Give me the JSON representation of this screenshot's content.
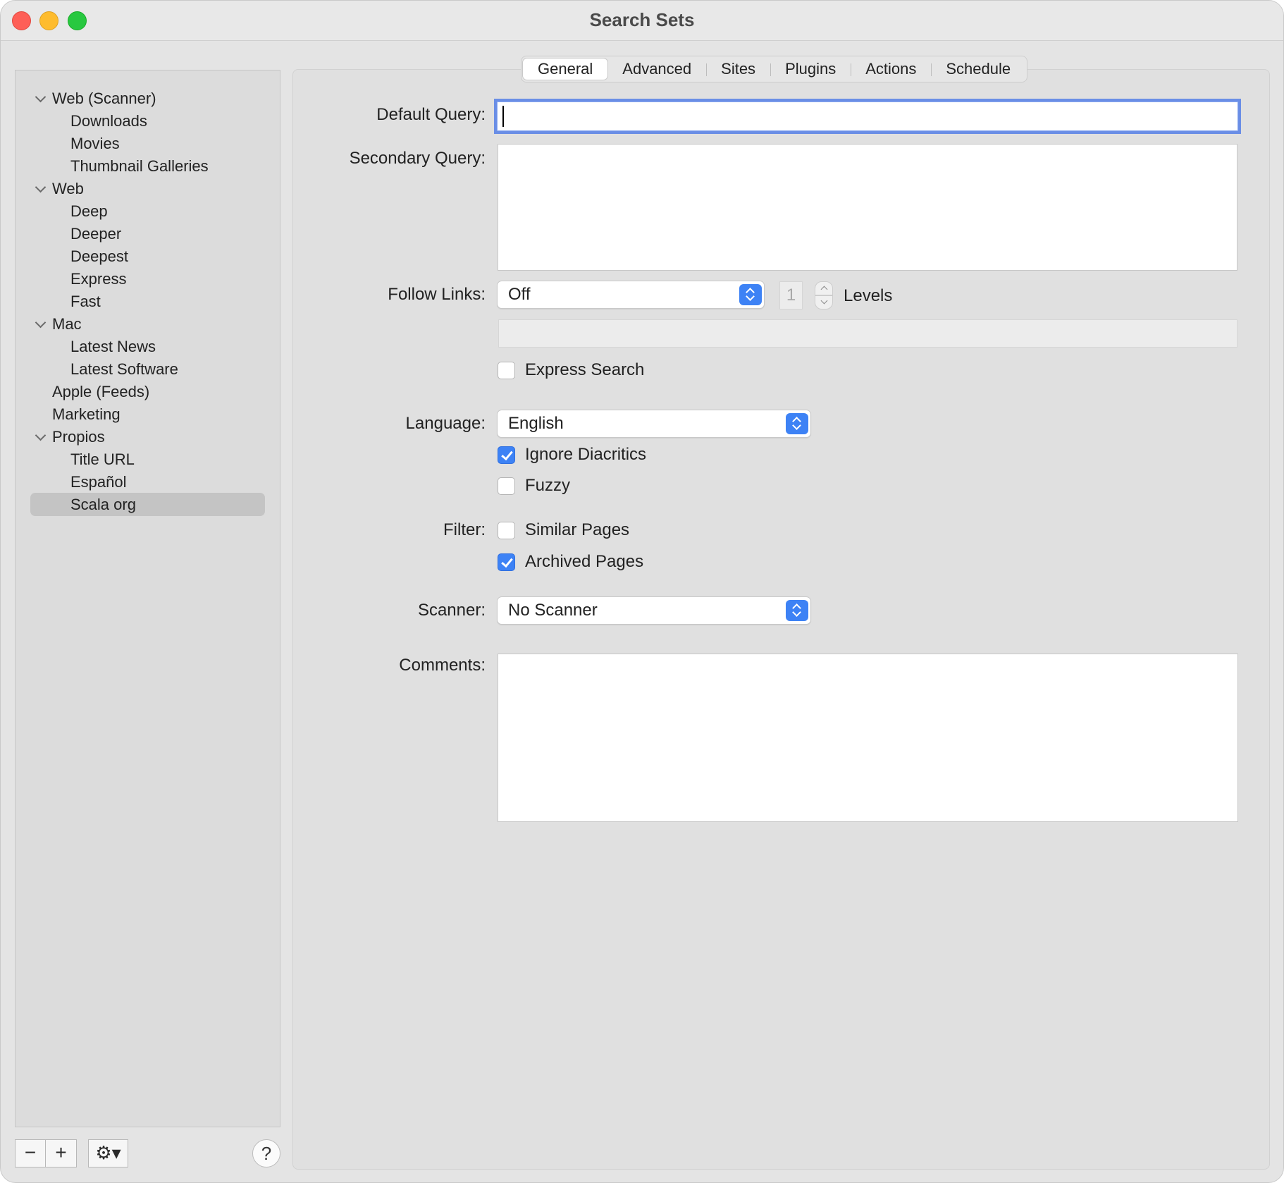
{
  "window": {
    "title": "Search Sets"
  },
  "sidebar": {
    "items": [
      {
        "label": "Web (Scanner)",
        "level": 0,
        "expandable": true
      },
      {
        "label": "Downloads",
        "level": 1
      },
      {
        "label": "Movies",
        "level": 1
      },
      {
        "label": "Thumbnail Galleries",
        "level": 1
      },
      {
        "label": "Web",
        "level": 0,
        "expandable": true
      },
      {
        "label": "Deep",
        "level": 1
      },
      {
        "label": "Deeper",
        "level": 1
      },
      {
        "label": "Deepest",
        "level": 1
      },
      {
        "label": "Express",
        "level": 1
      },
      {
        "label": "Fast",
        "level": 1
      },
      {
        "label": "Mac",
        "level": 0,
        "expandable": true
      },
      {
        "label": "Latest News",
        "level": 1
      },
      {
        "label": "Latest Software",
        "level": 1
      },
      {
        "label": "Apple (Feeds)",
        "level": 0
      },
      {
        "label": "Marketing",
        "level": 0
      },
      {
        "label": "Propios",
        "level": 0,
        "expandable": true
      },
      {
        "label": "Title URL",
        "level": 1
      },
      {
        "label": "Español",
        "level": 1
      },
      {
        "label": "Scala org",
        "level": 1,
        "selected": true
      }
    ],
    "buttons": {
      "remove": "−",
      "add": "+",
      "gear": "⚙▾",
      "help": "?"
    }
  },
  "tabs": [
    {
      "label": "General",
      "active": true
    },
    {
      "label": "Advanced"
    },
    {
      "label": "Sites"
    },
    {
      "label": "Plugins"
    },
    {
      "label": "Actions"
    },
    {
      "label": "Schedule"
    }
  ],
  "form": {
    "default_query": {
      "label": "Default Query:",
      "value": ""
    },
    "secondary_query": {
      "label": "Secondary Query:",
      "value": ""
    },
    "follow_links": {
      "label": "Follow Links:",
      "value": "Off",
      "levels_value": "1",
      "levels_label": "Levels"
    },
    "express_search": {
      "label": "Express Search",
      "checked": false
    },
    "language": {
      "label": "Language:",
      "value": "English"
    },
    "ignore_diacritics": {
      "label": "Ignore Diacritics",
      "checked": true
    },
    "fuzzy": {
      "label": "Fuzzy",
      "checked": false
    },
    "filter": {
      "label": "Filter:"
    },
    "similar_pages": {
      "label": "Similar Pages",
      "checked": false
    },
    "archived_pages": {
      "label": "Archived Pages",
      "checked": true
    },
    "scanner": {
      "label": "Scanner:",
      "value": "No Scanner"
    },
    "comments": {
      "label": "Comments:",
      "value": ""
    }
  },
  "colors": {
    "accent": "#3d82f5",
    "focus_ring": "#6a8ee6",
    "selection": "#c4c4c4"
  }
}
